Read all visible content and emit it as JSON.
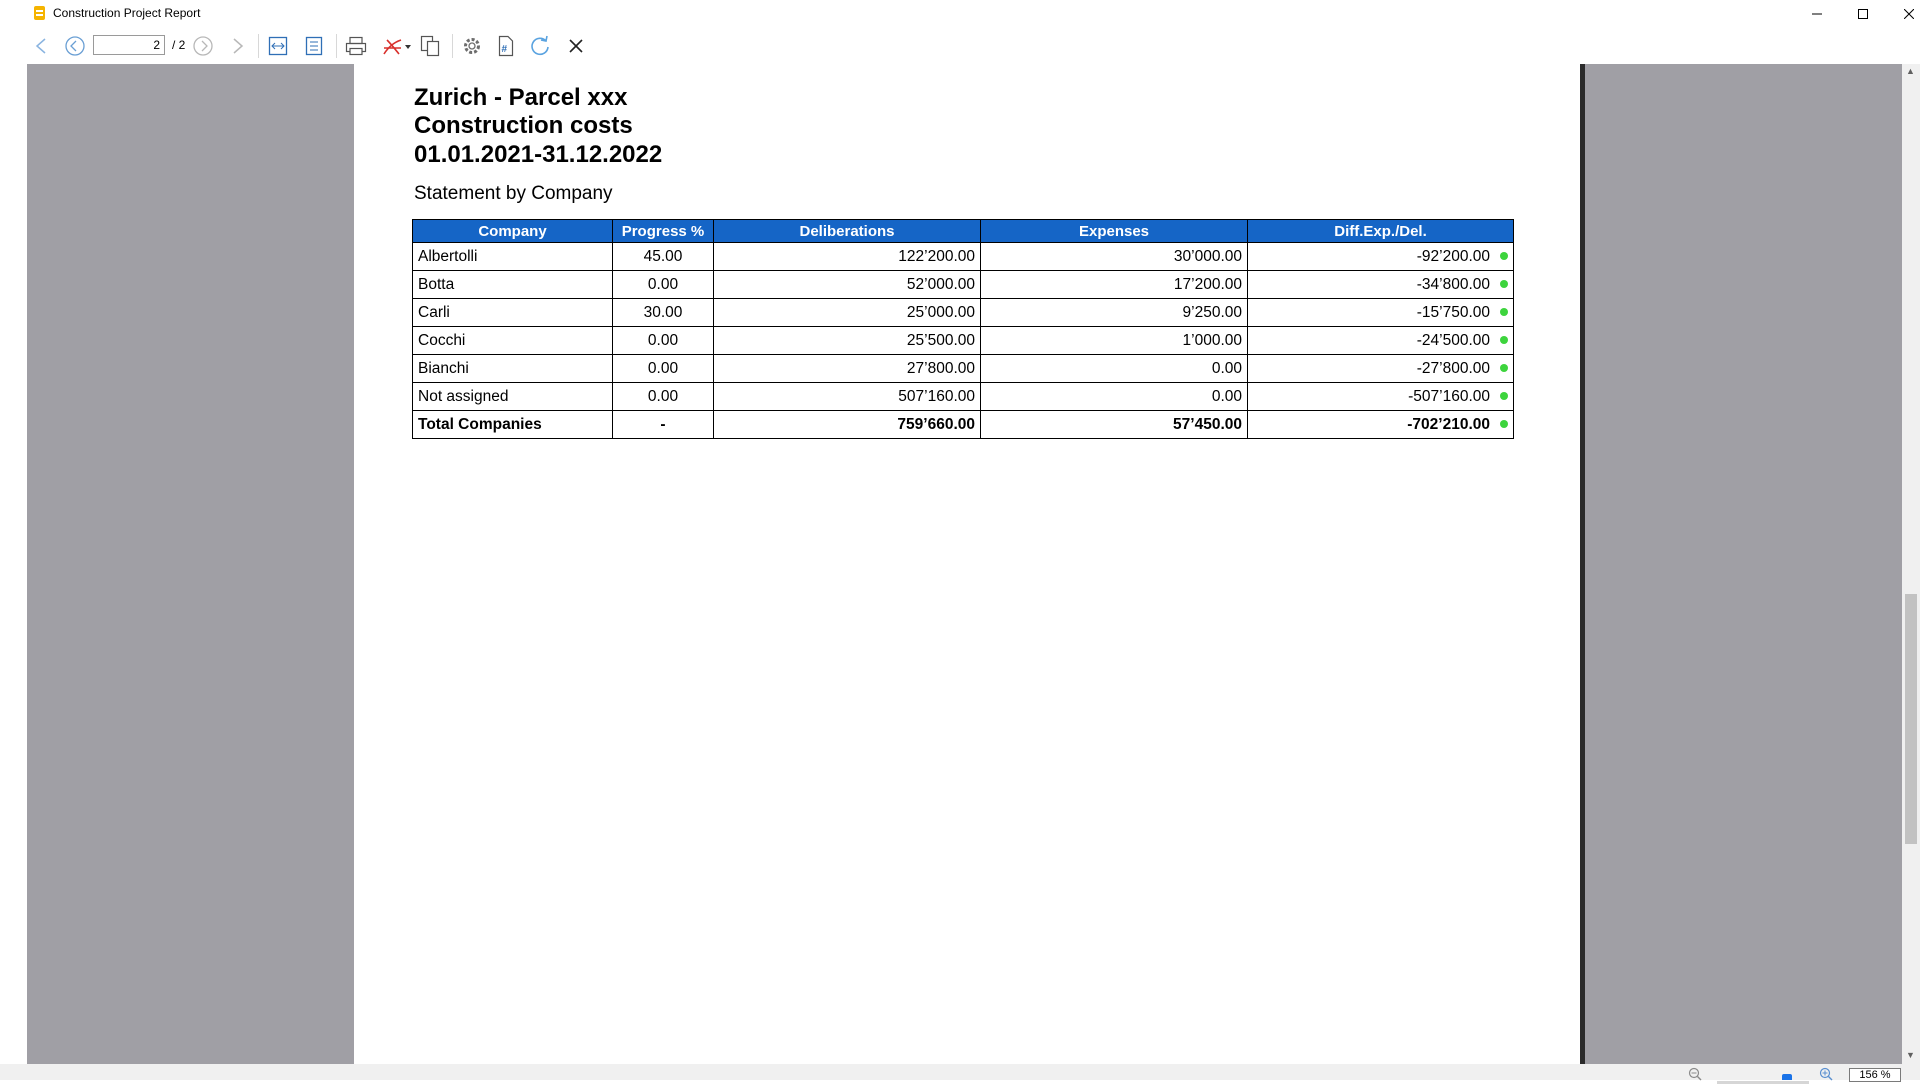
{
  "window": {
    "title": "Construction Project Report"
  },
  "toolbar": {
    "page_current": "2",
    "page_total": "/ 2",
    "icons": [
      "back-icon",
      "first-page-icon",
      "next-page-icon",
      "forward-icon",
      "fit-width-icon",
      "fit-page-icon",
      "print-icon",
      "pdf-export-icon",
      "copy-icon",
      "settings-icon",
      "page-number-icon",
      "refresh-icon",
      "close-icon"
    ]
  },
  "report": {
    "title_lines": [
      "Zurich - Parcel xxx",
      "Construction costs",
      "01.01.2021-31.12.2022"
    ],
    "subtitle": "Statement by Company",
    "columns": [
      "Company",
      "Progress %",
      "Deliberations",
      "Expenses",
      "Diff.Exp./Del."
    ],
    "rows": [
      [
        "Albertolli",
        "45.00",
        "122’200.00",
        "30’000.00",
        "-92’200.00"
      ],
      [
        "Botta",
        "0.00",
        "52’000.00",
        "17’200.00",
        "-34’800.00"
      ],
      [
        "Carli",
        "30.00",
        "25’000.00",
        "9’250.00",
        "-15’750.00"
      ],
      [
        "Cocchi",
        "0.00",
        "25’500.00",
        "1’000.00",
        "-24’500.00"
      ],
      [
        "Bianchi",
        "0.00",
        "27’800.00",
        "0.00",
        "-27’800.00"
      ],
      [
        "Not assigned",
        "0.00",
        "507’160.00",
        "0.00",
        "-507’160.00"
      ]
    ],
    "total": [
      "Total Companies",
      "-",
      "759’660.00",
      "57’450.00",
      "-702’210.00"
    ],
    "status_color": "#3dd43d",
    "header_color": "#1565c6"
  },
  "statusbar": {
    "zoom": "156 %",
    "zoom_level": 0.76
  }
}
